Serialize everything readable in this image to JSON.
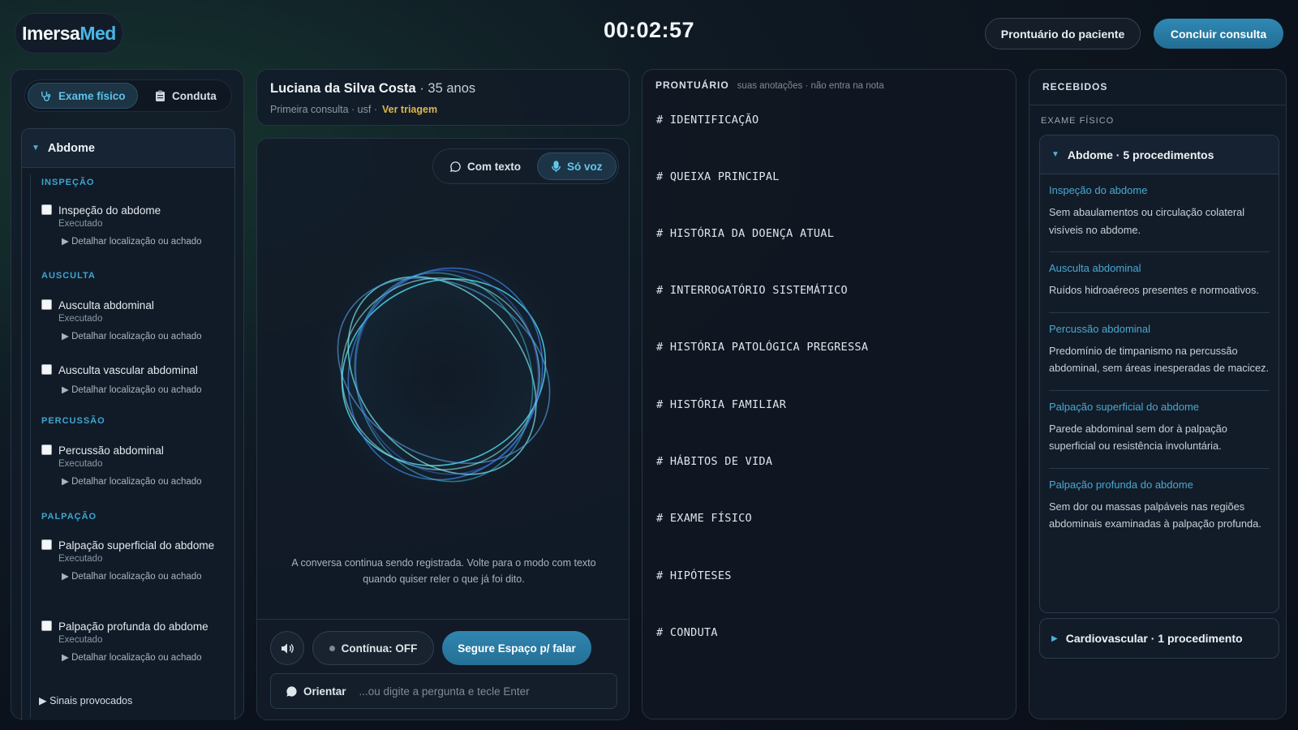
{
  "header": {
    "logo_part1": "Imersa",
    "logo_part2": "Med",
    "timer": "00:02:57",
    "record_button": "Prontuário do paciente",
    "finish_button": "Concluir consulta"
  },
  "left": {
    "tabs": [
      {
        "label": "Exame físico",
        "icon": "stethoscope-icon",
        "active": true
      },
      {
        "label": "Conduta",
        "icon": "clipboard-icon",
        "active": false
      }
    ],
    "group_title": "Abdome",
    "sections": [
      {
        "title": "INSPEÇÃO",
        "items": [
          {
            "name": "Inspeção do abdome",
            "status": "Executado",
            "detail": "Detalhar localização ou achado"
          }
        ]
      },
      {
        "title": "AUSCULTA",
        "items": [
          {
            "name": "Ausculta abdominal",
            "status": "Executado",
            "detail": "Detalhar localização ou achado"
          },
          {
            "name": "Ausculta vascular abdominal",
            "status": "",
            "detail": "Detalhar localização ou achado"
          }
        ]
      },
      {
        "title": "PERCUSSÃO",
        "items": [
          {
            "name": "Percussão abdominal",
            "status": "Executado",
            "detail": "Detalhar localização ou achado"
          }
        ]
      },
      {
        "title": "PALPAÇÃO",
        "items": [
          {
            "name": "Palpação superficial do abdome",
            "status": "Executado",
            "detail": "Detalhar localização ou achado"
          },
          {
            "name": "Palpação profunda do abdome",
            "status": "Executado",
            "detail": "Detalhar localização ou achado"
          }
        ]
      }
    ],
    "sinais": "Sinais provocados"
  },
  "patient": {
    "name": "Luciana da Silva Costa",
    "age": "35 anos",
    "subtitle": "Primeira consulta · usf  ·",
    "triage_link": "Ver triagem"
  },
  "voice": {
    "mode_text": "Com texto",
    "mode_voice": "Só voz",
    "note": "A conversa continua sendo registrada. Volte para o modo com texto quando quiser reler o que já foi dito.",
    "continua": "Contínua: OFF",
    "talk": "Segure Espaço p/ falar",
    "orientar": "Orientar",
    "placeholder": "...ou digite a pergunta e tecle Enter"
  },
  "prontuario": {
    "title": "PRONTUÁRIO",
    "subtitle": "suas anotações · não entra na nota",
    "lines": [
      "# IDENTIFICAÇÃO",
      "# QUEIXA PRINCIPAL",
      "# HISTÓRIA DA DOENÇA ATUAL",
      "# INTERROGATÓRIO SISTEMÁTICO",
      "# HISTÓRIA PATOLÓGICA PREGRESSA",
      "# HISTÓRIA FAMILIAR",
      "# HÁBITOS DE VIDA",
      "# EXAME FÍSICO",
      "# HIPÓTESES",
      "# CONDUTA"
    ]
  },
  "recebidos": {
    "title": "RECEBIDOS",
    "section": "EXAME FÍSICO",
    "groups": [
      {
        "title": "Abdome · 5 procedimentos",
        "expanded": true,
        "findings": [
          {
            "title": "Inspeção do abdome",
            "text": "Sem abaulamentos ou circulação colateral visíveis no abdome."
          },
          {
            "title": "Ausculta abdominal",
            "text": "Ruídos hidroaéreos presentes e normoativos."
          },
          {
            "title": "Percussão abdominal",
            "text": "Predomínio de timpanismo na percussão abdominal, sem áreas inesperadas de macicez."
          },
          {
            "title": "Palpação superficial do abdome",
            "text": "Parede abdominal sem dor à palpação superficial ou resistência involuntária."
          },
          {
            "title": "Palpação profunda do abdome",
            "text": "Sem dor ou massas palpáveis nas regiões abdominais examinadas à palpação profunda."
          }
        ]
      },
      {
        "title": "Cardiovascular · 1 procedimento",
        "expanded": false
      }
    ]
  },
  "colors": {
    "accent": "#49b7e8",
    "link_gold": "#e0b54a",
    "primary_button": "#2a7aa5"
  }
}
